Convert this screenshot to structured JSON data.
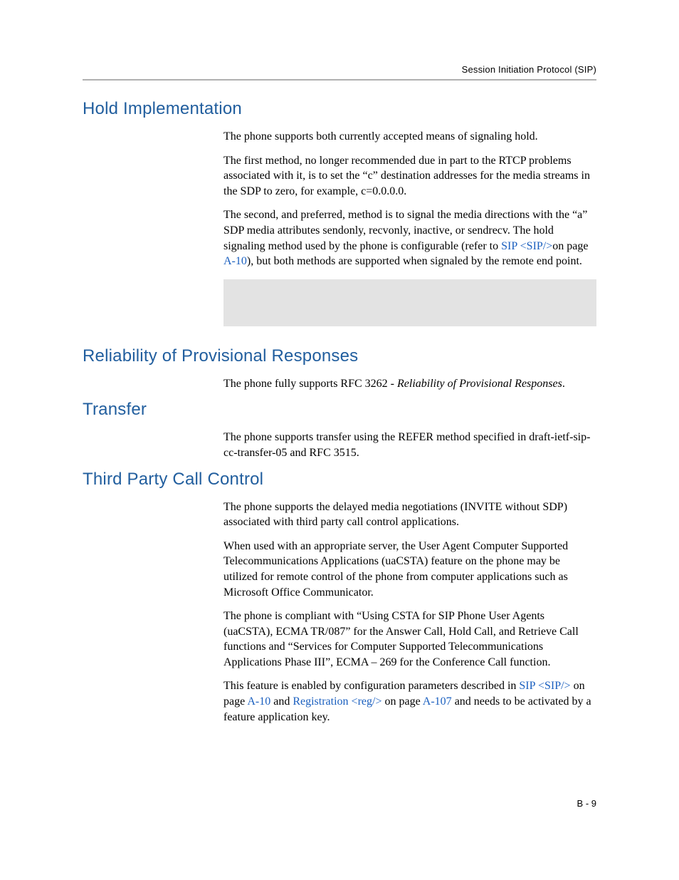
{
  "header": {
    "title": "Session Initiation Protocol (SIP)"
  },
  "sections": {
    "hold": {
      "title": "Hold Implementation",
      "p1": "The phone supports both currently accepted means of signaling hold.",
      "p2": "The first method, no longer recommended due in part to the RTCP problems associated with it, is to set the “c” destination addresses for the media streams in the SDP to zero, for example, c=0.0.0.0.",
      "p3_a": "The second, and preferred, method is to signal the media directions with the “a” SDP media attributes sendonly, recvonly, inactive, or sendrecv. The hold signaling method used by the phone is configurable (refer to ",
      "p3_link1": "SIP <SIP/>",
      "p3_b": "on page ",
      "p3_link2": "A-10",
      "p3_c": "), but both methods are supported when signaled by the remote end point."
    },
    "reliability": {
      "title": "Reliability of Provisional Responses",
      "p1_a": "The phone fully supports RFC 3262 - ",
      "p1_i": "Reliability of Provisional Responses",
      "p1_b": "."
    },
    "transfer": {
      "title": "Transfer",
      "p1": "The phone supports transfer using the REFER method specified in draft-ietf-sip-cc-transfer-05 and RFC 3515."
    },
    "tpcc": {
      "title": "Third Party Call Control",
      "p1": "The phone supports the delayed media negotiations (INVITE without SDP) associated with third party call control applications.",
      "p2": "When used with an appropriate server, the User Agent Computer Supported Telecommunications Applications (uaCSTA) feature on the phone may be utilized for remote control of the phone from computer applications such as Microsoft Office Communicator.",
      "p3": "The phone is compliant with “Using CSTA for SIP Phone User Agents (uaCSTA), ECMA TR/087” for the Answer Call, Hold Call, and Retrieve Call functions and “Services for Computer Supported Telecommunications Applications Phase III”, ECMA – 269 for the Conference Call function.",
      "p4_a": "This feature is enabled by configuration parameters described in ",
      "p4_link1": "SIP <SIP/>",
      "p4_b": " on page ",
      "p4_link2": "A-10",
      "p4_c": " and ",
      "p4_link3": "Registration <reg/>",
      "p4_d": " on page ",
      "p4_link4": "A-107",
      "p4_e": " and needs to be activated by a feature application key."
    }
  },
  "footer": {
    "page_number": "B - 9"
  }
}
